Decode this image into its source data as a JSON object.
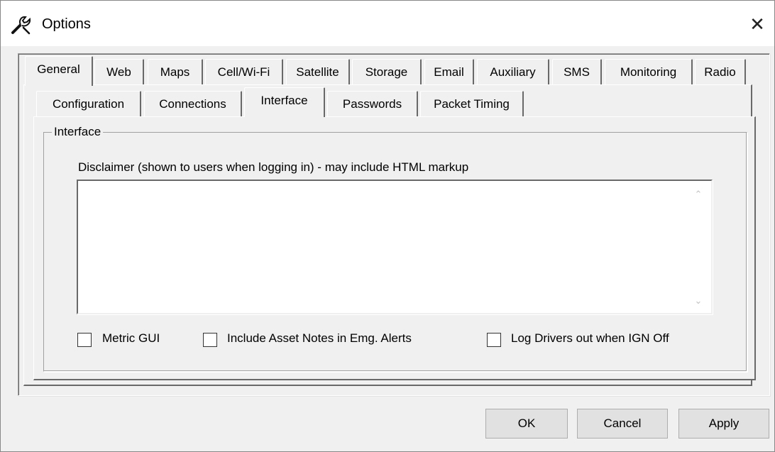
{
  "window": {
    "title": "Options",
    "close_glyph": "✕",
    "icon": "wrench-icon"
  },
  "top_tabs": [
    "General",
    "Web",
    "Maps",
    "Cell/Wi-Fi",
    "Satellite",
    "Storage",
    "Email",
    "Auxiliary",
    "SMS",
    "Monitoring",
    "Radio"
  ],
  "active_top_tab": "General",
  "sub_tabs": [
    "Configuration",
    "Connections",
    "Interface",
    "Passwords",
    "Packet Timing"
  ],
  "active_sub_tab": "Interface",
  "group": {
    "title": "Interface",
    "disclaimer_label": "Disclaimer (shown to users when logging in) - may include HTML markup",
    "disclaimer_value": "",
    "checkboxes": [
      {
        "label": "Metric GUI",
        "checked": false
      },
      {
        "label": "Include Asset Notes in Emg. Alerts",
        "checked": false
      },
      {
        "label": "Log Drivers out when IGN Off",
        "checked": false
      }
    ]
  },
  "buttons": {
    "ok": "OK",
    "cancel": "Cancel",
    "apply": "Apply"
  }
}
